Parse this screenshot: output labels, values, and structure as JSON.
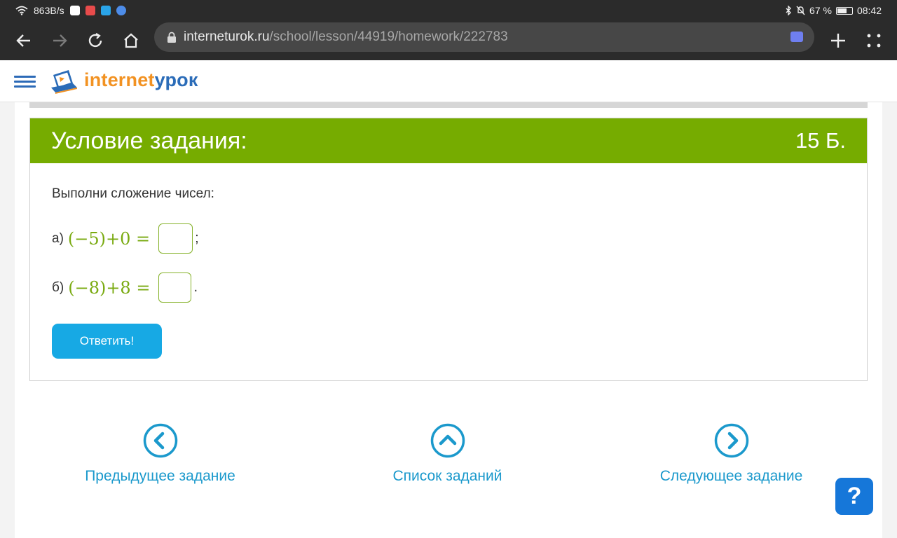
{
  "status_bar": {
    "speed": "863B/s",
    "battery": "67 %",
    "battery_level": 0.67,
    "time": "08:42"
  },
  "browser": {
    "url_host": "interneturok.ru",
    "url_path": "/school/lesson/44919/homework/222783"
  },
  "site": {
    "logo_part1": "internet",
    "logo_part2": "урок"
  },
  "task": {
    "title": "Условие задания:",
    "points": "15 Б.",
    "instruction": "Выполни сложение чисел:",
    "item_a_label": "а)",
    "item_a_expr": "(−5)+0 =",
    "item_a_punct": ";",
    "item_b_label": "б)",
    "item_b_expr": "(−8)+8 =",
    "item_b_punct": ".",
    "submit_label": "Ответить!"
  },
  "nav": {
    "prev_label": "Предыдущее задание",
    "list_label": "Список заданий",
    "next_label": "Следующее задание"
  },
  "help": {
    "label": "?"
  },
  "colors": {
    "header_green": "#76ac00",
    "button_blue": "#17a9e4",
    "link_blue": "#1b99cc",
    "help_blue": "#1677d9",
    "brand_orange": "#f29222",
    "brand_blue": "#2b6cb8"
  }
}
